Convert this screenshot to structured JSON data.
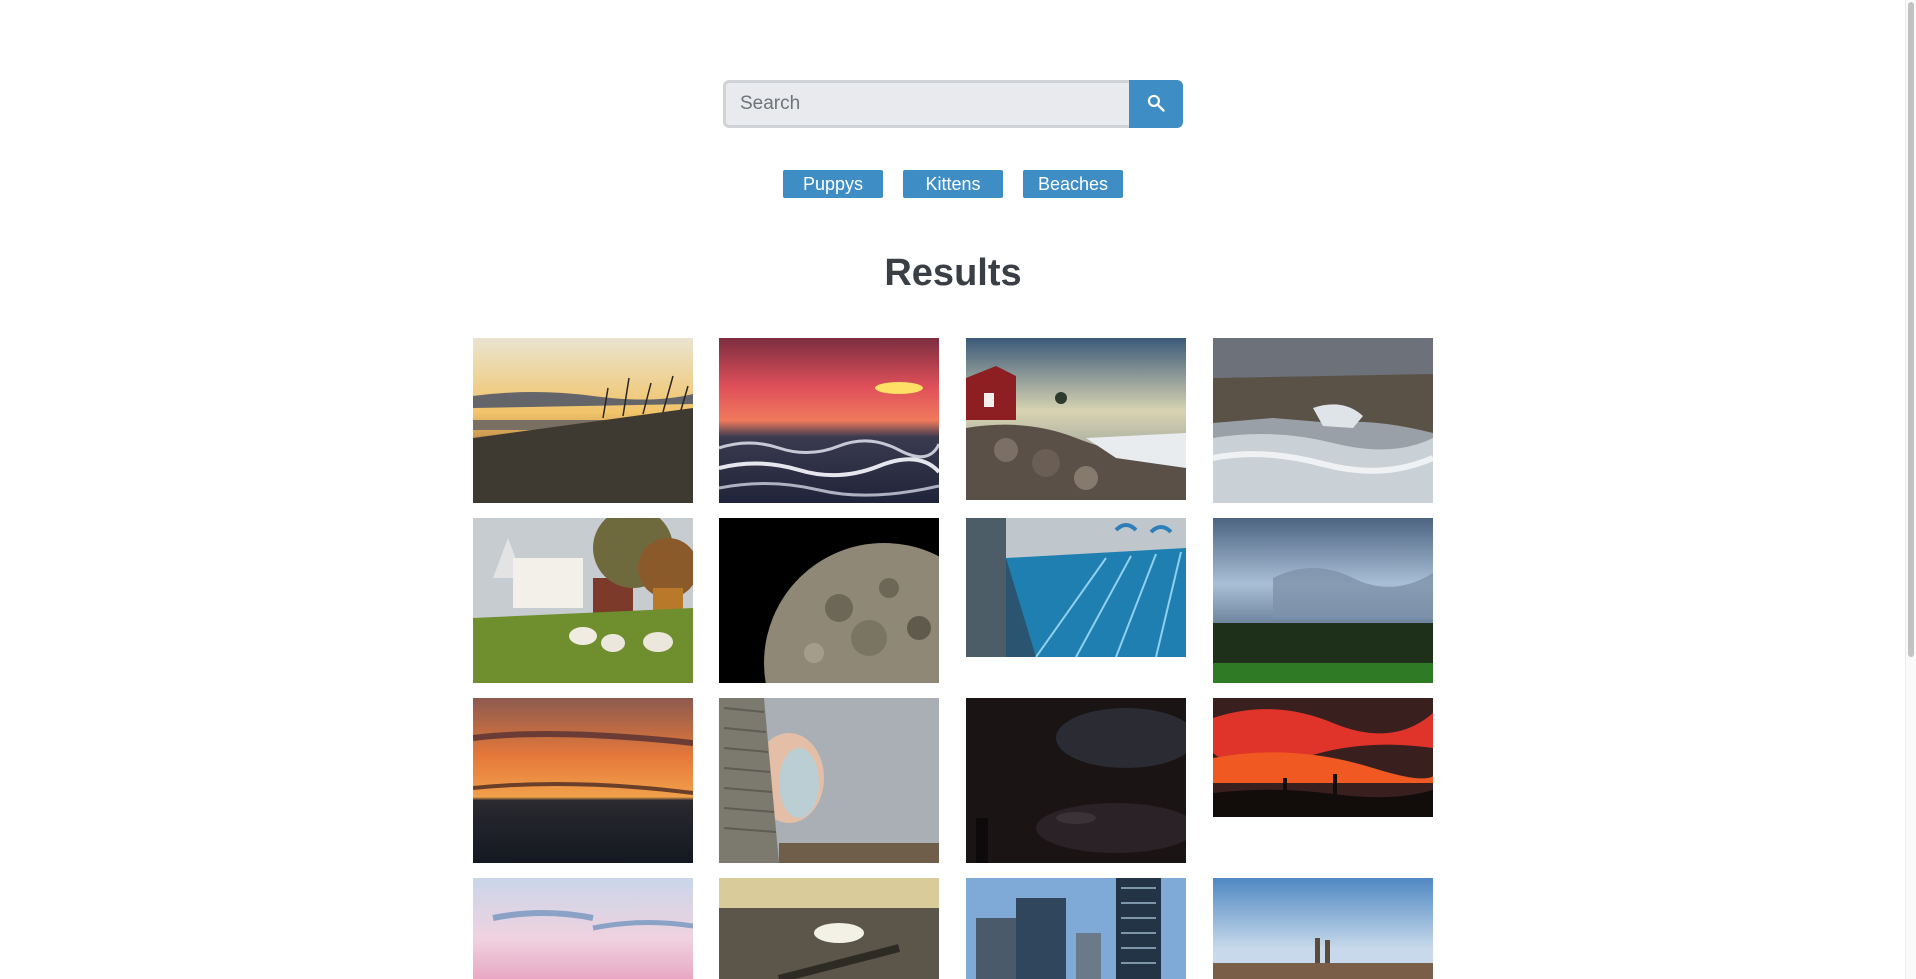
{
  "search": {
    "placeholder": "Search",
    "value": "",
    "button_icon": "search-icon"
  },
  "quick_filters": [
    "Puppys",
    "Kittens",
    "Beaches"
  ],
  "results": {
    "title": "Results"
  },
  "colors": {
    "accent": "#3f8dc5",
    "title_text": "#3a3f45",
    "input_bg": "#e8eaed"
  }
}
